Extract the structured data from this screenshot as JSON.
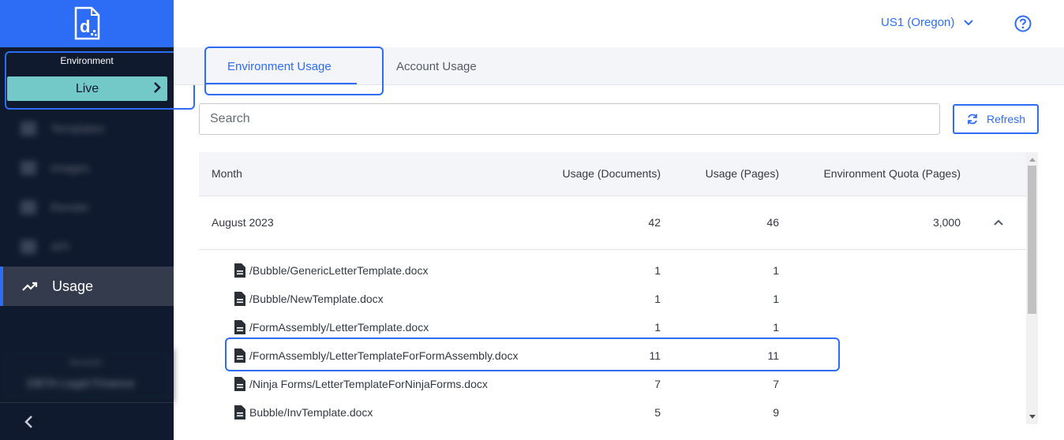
{
  "sidebar": {
    "environment_label": "Environment",
    "environment_value": "Live",
    "nav": [
      {
        "label": "Templates",
        "icon": "file-icon"
      },
      {
        "label": "Images",
        "icon": "image-icon"
      },
      {
        "label": "Render",
        "icon": "render-icon"
      },
      {
        "label": "API",
        "icon": "api-icon"
      },
      {
        "label": "Usage",
        "icon": "trending-up-icon"
      }
    ],
    "account_label": "Account",
    "account_name": "DBTA Legal Finance"
  },
  "header": {
    "region": "US1 (Oregon)"
  },
  "tabs": [
    {
      "label": "Environment Usage",
      "active": true
    },
    {
      "label": "Account Usage",
      "active": false
    }
  ],
  "search": {
    "placeholder": "Search"
  },
  "refresh_label": "Refresh",
  "table": {
    "headers": {
      "month": "Month",
      "documents": "Usage (Documents)",
      "pages": "Usage (Pages)",
      "quota": "Environment Quota (Pages)"
    },
    "month_row": {
      "month": "August 2023",
      "documents": "42",
      "pages": "46",
      "quota": "3,000"
    },
    "files": [
      {
        "name": "/Bubble/GenericLetterTemplate.docx",
        "documents": "1",
        "pages": "1"
      },
      {
        "name": "/Bubble/NewTemplate.docx",
        "documents": "1",
        "pages": "1"
      },
      {
        "name": "/FormAssembly/LetterTemplate.docx",
        "documents": "1",
        "pages": "1"
      },
      {
        "name": "/FormAssembly/LetterTemplateForFormAssembly.docx",
        "documents": "11",
        "pages": "11"
      },
      {
        "name": "/Ninja Forms/LetterTemplateForNinjaForms.docx",
        "documents": "7",
        "pages": "7"
      },
      {
        "name": "Bubble/InvTemplate.docx",
        "documents": "5",
        "pages": "9"
      }
    ]
  },
  "colors": {
    "accent": "#2d6df6",
    "sidebar": "#0f1a2e",
    "env_live": "#72c9c8"
  }
}
